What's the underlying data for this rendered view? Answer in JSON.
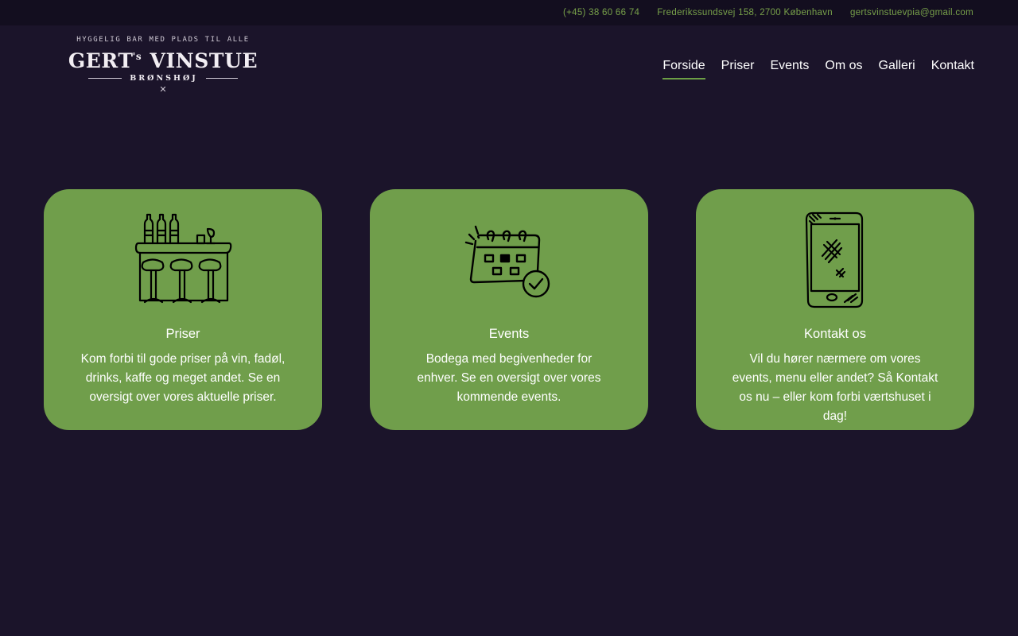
{
  "topbar": {
    "phone": "(+45) 38 60 66 74",
    "address": "Frederikssundsvej 158, 2700 København",
    "email": "gertsvinstuevpia@gmail.com"
  },
  "logo": {
    "tagline": "HYGGELIG BAR MED PLADS TIL ALLE",
    "name_part1": "GERT",
    "name_sup": "'s",
    "name_part2": "VINSTUE",
    "place": "BRØNSHØJ",
    "ornament": "✕"
  },
  "nav": {
    "items": [
      {
        "label": "Forside",
        "active": true
      },
      {
        "label": "Priser"
      },
      {
        "label": "Events"
      },
      {
        "label": "Om os"
      },
      {
        "label": "Galleri"
      },
      {
        "label": "Kontakt"
      }
    ]
  },
  "cards": [
    {
      "icon": "bar-counter-icon",
      "title": "Priser",
      "text": "Kom forbi til gode priser på vin, fadøl, drinks, kaffe og meget andet. Se en oversigt over vores aktuelle priser."
    },
    {
      "icon": "calendar-check-icon",
      "title": "Events",
      "text": "Bodega med begivenheder for enhver. Se en oversigt over vores kommende events."
    },
    {
      "icon": "mobile-phone-icon",
      "title": "Kontakt os",
      "text": "Vil du hører nærmere om vores events, menu eller andet? Så Kontakt os nu – eller kom forbi værtshuset i dag!"
    }
  ],
  "colors": {
    "background": "#1b142a",
    "topbar": "#130e1f",
    "accent_green": "#709e4b",
    "topbar_text": "#78a14a"
  }
}
